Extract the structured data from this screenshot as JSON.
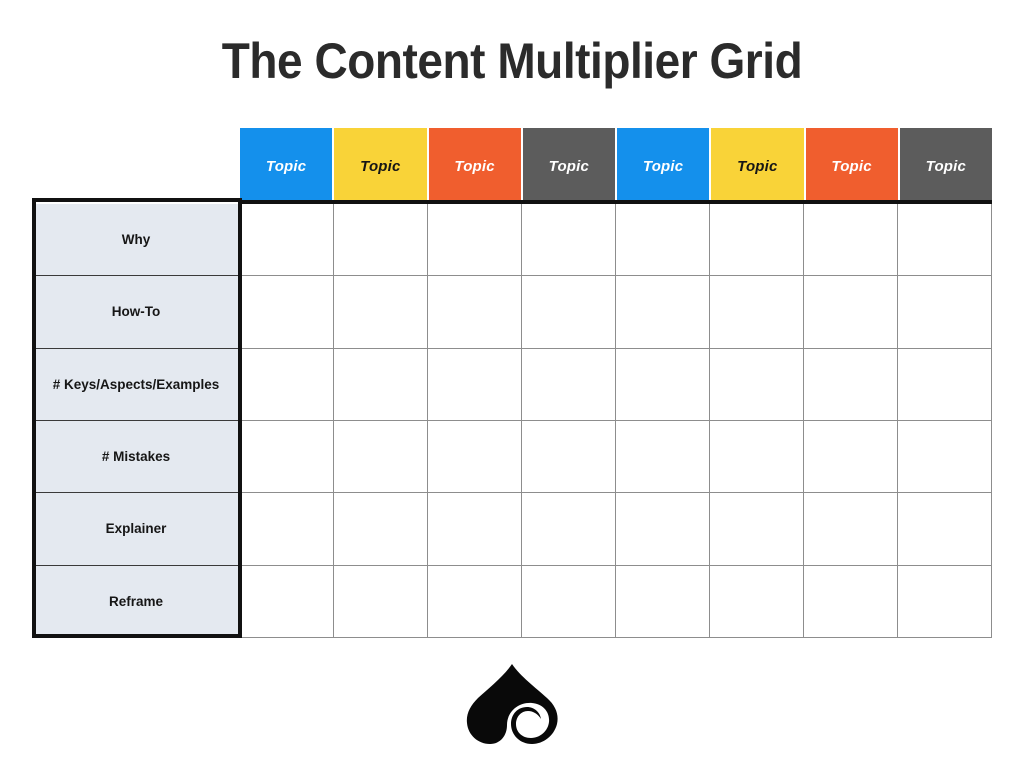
{
  "page": {
    "title": "The Content Multiplier Grid",
    "background": "#ffffff"
  },
  "grid": {
    "column_header_label": "Topic",
    "columns": [
      {
        "label": "Topic",
        "color": "#1490ec",
        "text_color": "#ffffff"
      },
      {
        "label": "Topic",
        "color": "#f9d338",
        "text_color": "#161616"
      },
      {
        "label": "Topic",
        "color": "#f05e2e",
        "text_color": "#ffffff"
      },
      {
        "label": "Topic",
        "color": "#5c5c5c",
        "text_color": "#ffffff"
      },
      {
        "label": "Topic",
        "color": "#1490ec",
        "text_color": "#ffffff"
      },
      {
        "label": "Topic",
        "color": "#f9d338",
        "text_color": "#161616"
      },
      {
        "label": "Topic",
        "color": "#f05e2e",
        "text_color": "#ffffff"
      },
      {
        "label": "Topic",
        "color": "#5c5c5c",
        "text_color": "#ffffff"
      }
    ],
    "rows": [
      {
        "label": "Why",
        "cells": [
          "",
          "",
          "",
          "",
          "",
          "",
          "",
          ""
        ]
      },
      {
        "label": "How-To",
        "cells": [
          "",
          "",
          "",
          "",
          "",
          "",
          "",
          ""
        ]
      },
      {
        "label": "# Keys/Aspects/Examples",
        "cells": [
          "",
          "",
          "",
          "",
          "",
          "",
          "",
          ""
        ]
      },
      {
        "label": "# Mistakes",
        "cells": [
          "",
          "",
          "",
          "",
          "",
          "",
          "",
          ""
        ]
      },
      {
        "label": "Explainer",
        "cells": [
          "",
          "",
          "",
          "",
          "",
          "",
          "",
          ""
        ]
      },
      {
        "label": "Reframe",
        "cells": [
          "",
          "",
          "",
          "",
          "",
          "",
          "",
          ""
        ]
      }
    ],
    "row_label_background": "#e4e9f0",
    "cell_background": "#ffffff",
    "frame_color": "#111111",
    "gridline_color": "#8d8d8d"
  },
  "logo": {
    "name": "spade-spiral-logo",
    "color": "#090909"
  }
}
